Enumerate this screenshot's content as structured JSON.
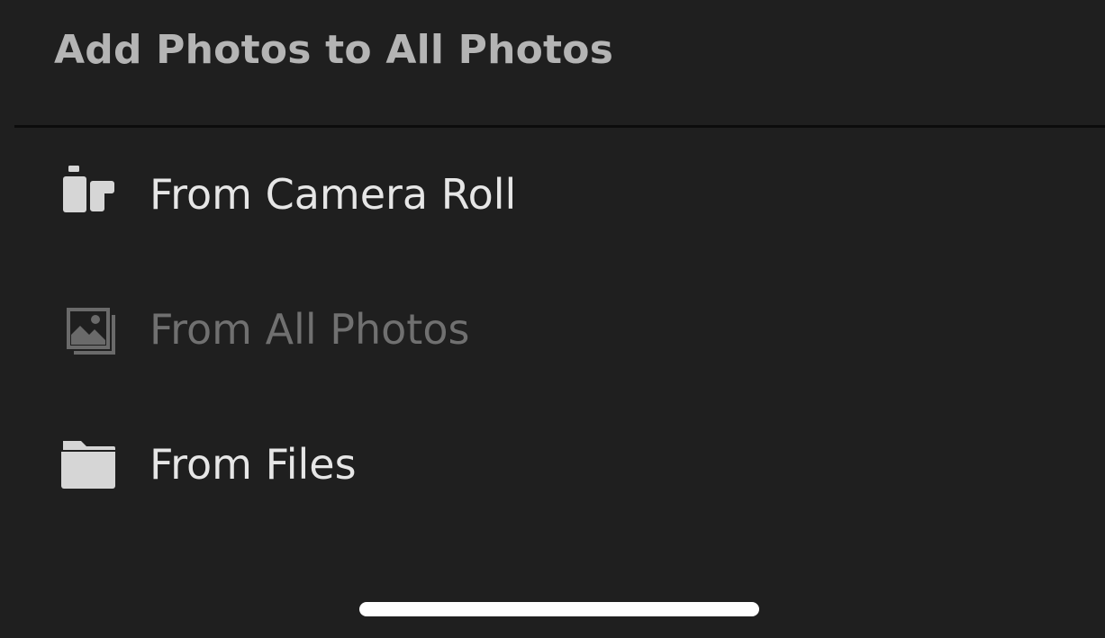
{
  "sheet": {
    "title": "Add Photos to All Photos"
  },
  "menu": {
    "items": [
      {
        "label": "From Camera Roll",
        "icon": "camera-roll-icon",
        "enabled": true
      },
      {
        "label": "From All Photos",
        "icon": "photos-icon",
        "enabled": false
      },
      {
        "label": "From Files",
        "icon": "folder-icon",
        "enabled": true
      }
    ]
  },
  "colors": {
    "background": "#1f1f1f",
    "title": "#b4b4b4",
    "label": "#e6e6e6",
    "label_disabled": "#707070",
    "icon": "#d6d6d6",
    "icon_disabled": "#6a6a6a",
    "divider": "#0c0c0c",
    "home_indicator": "#ffffff"
  }
}
